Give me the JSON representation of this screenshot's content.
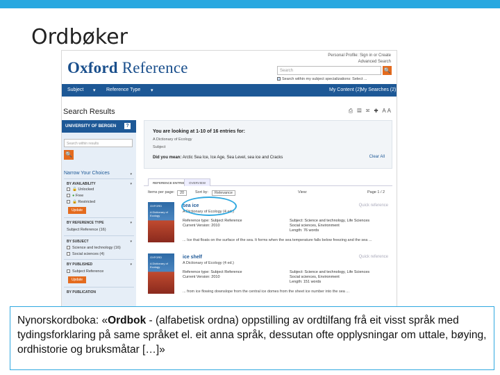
{
  "slide": {
    "title": "Ordbøker"
  },
  "site": {
    "logo_a": "Oxford",
    "logo_b": " Reference",
    "toplinks_1": "Personal Profile: Sign in or Create",
    "toplinks_2": "Advanced Search",
    "search_placeholder": "Search",
    "search_button": "🔍",
    "within_label": "Search within my subject specializations: Select ..."
  },
  "nav": {
    "subject": "Subject",
    "reference_type": "Reference Type",
    "my_content": "My Content (2)",
    "my_searches": "My Searches (2)"
  },
  "results": {
    "title": "Search Results",
    "tools": "⎙ ▤ ✉ ✚ AA"
  },
  "sidebar": {
    "institution": "UNIVERSITY OF BERGEN",
    "help": "?",
    "search_placeholder": "Search within results",
    "search_button": "🔍",
    "narrow": "Narrow Your Choices",
    "availability_heading": "BY AVAILABILITY",
    "avail_1": "Unlocked",
    "avail_2": "Free",
    "avail_3": "Restricted",
    "update": "Update",
    "reftype_heading": "BY REFERENCE TYPE",
    "reftype_1": "Subject Reference (16)",
    "subject_heading": "BY SUBJECT",
    "subject_1": "Science and technology (16)",
    "subject_2": "Social sciences (4)",
    "published_heading": "BY PUBLISHED",
    "published_1": "Subject Reference",
    "update2": "Update",
    "more_heading": "BY PUBLICATION"
  },
  "panel": {
    "heading": "You are looking at 1-10 of 16 entries for:",
    "line1": "A Dictionary of Ecology",
    "line2": "Subject",
    "did_you_mean_label": "Did you mean:",
    "did_you_mean_text": "Arctic Sea Ice, Ice Age, Sea Level, sea ice and Cracks",
    "clear_all": "Clear All"
  },
  "tabs": {
    "tab1": "REFERENCE ENTRIES",
    "tab2": "OVERVIEW"
  },
  "sort": {
    "per_page_label": "Items per page:",
    "per_page": "20",
    "sort_label": "Sort by:",
    "sort_value": "Relevance",
    "view": "View:",
    "page": "Page 1 / 2"
  },
  "entries": [
    {
      "cover_brand": "OXFORD",
      "cover_title": "A Dictionary of Ecology",
      "title": "sea ice",
      "source": "A Dictionary of Ecology (4 ed.)",
      "meta1": "Reference type: Subject Reference",
      "meta2": "Current Version: 2010",
      "subject": "Subject: Science and technology, Life Sciences",
      "subject2": "Social sciences, Environment",
      "length": "Length: 76 words",
      "quick": "Quick reference",
      "snippet": "... Ice that floats on the surface of the sea. It forms when the sea temperature falls below freezing and the sea ..."
    },
    {
      "cover_brand": "OXFORD",
      "cover_title": "A Dictionary of Ecology",
      "title": "ice shelf",
      "source": "A Dictionary of Ecology (4 ed.)",
      "meta1": "Reference type: Subject Reference",
      "meta2": "Current Version: 2010",
      "subject": "Subject: Science and technology, Life Sciences",
      "subject2": "Social sciences, Environment",
      "length": "Length: 151 words",
      "quick": "Quick reference",
      "snippet": "... from ice flowing downslope from the central ice domes from the sheet ice number into the sea ..."
    }
  ],
  "note": {
    "p1": "Nynorskordboka: «",
    "bold": "Ordbok",
    "p2": " - (alfabetisk ordna) oppstilling av ordtilfang frå eit visst språk med   tydingsforklaring på same språket el. eit anna språk, dessutan ofte opplysningar om uttale, bøying,     ordhistorie og bruksmåtar […]»"
  },
  "colors": {
    "accent": "#29a8e0",
    "oxford_blue": "#1d5896",
    "orange": "#e46b1e"
  }
}
